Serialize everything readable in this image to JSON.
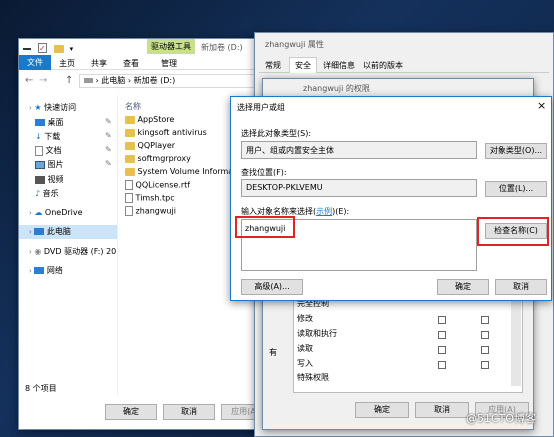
{
  "explorer": {
    "ribbon_tabs": [
      "文件",
      "主页",
      "共享",
      "查看"
    ],
    "drive_tools": "驱动器工具",
    "manage": "管理",
    "title": "新加卷 (D:)",
    "path": [
      "此电脑",
      "新加卷 (D:)"
    ],
    "column_name": "名称",
    "sidebar": [
      "快速访问",
      "桌面",
      "下载",
      "文档",
      "图片",
      "视频",
      "音乐",
      "OneDrive",
      "此电脑",
      "DVD 驱动器 (F:) 201",
      "网络"
    ],
    "files": [
      "AppStore",
      "kingsoft antivirus",
      "QQPlayer",
      "softmgrproxy",
      "System Volume Information",
      "QQLicense.rtf",
      "Timsh.tpc",
      "zhangwuji"
    ],
    "status": "8 个项目",
    "ok": "确定",
    "cancel": "取消",
    "apply": "应用(A)"
  },
  "props": {
    "title": "zhangwuji 属性",
    "tabs": [
      "常规",
      "安全",
      "详细信息",
      "以前的版本"
    ],
    "obj_prefix": "对"
  },
  "perms": {
    "title": "zhangwuji 的权限",
    "rows": [
      "完全控制",
      "修改",
      "读取和执行",
      "读取",
      "写入",
      "特殊权限"
    ],
    "left_label": "有",
    "ok": "确定",
    "cancel": "取消",
    "apply": "应用(A)"
  },
  "dialog": {
    "title": "选择用户或组",
    "type_label": "选择此对象类型(S):",
    "type_value": "用户、组或内置安全主体",
    "type_button": "对象类型(O)...",
    "loc_label": "查找位置(F):",
    "loc_value": "DESKTOP-PKLVEMU",
    "loc_button": "位置(L)...",
    "name_label_pre": "输入对象名称来选择(",
    "name_label_link": "示例",
    "name_label_post": ")(E):",
    "name_value": "zhangwuji",
    "check_button": "检查名称(C)",
    "advanced_button": "高级(A)...",
    "ok": "确定",
    "cancel": "取消",
    "close": "×"
  },
  "watermark": "@51CTO博客",
  "colors": {
    "accent": "#1979ca",
    "highlight": "#e02424",
    "drive_tools": "#c8e08e"
  }
}
